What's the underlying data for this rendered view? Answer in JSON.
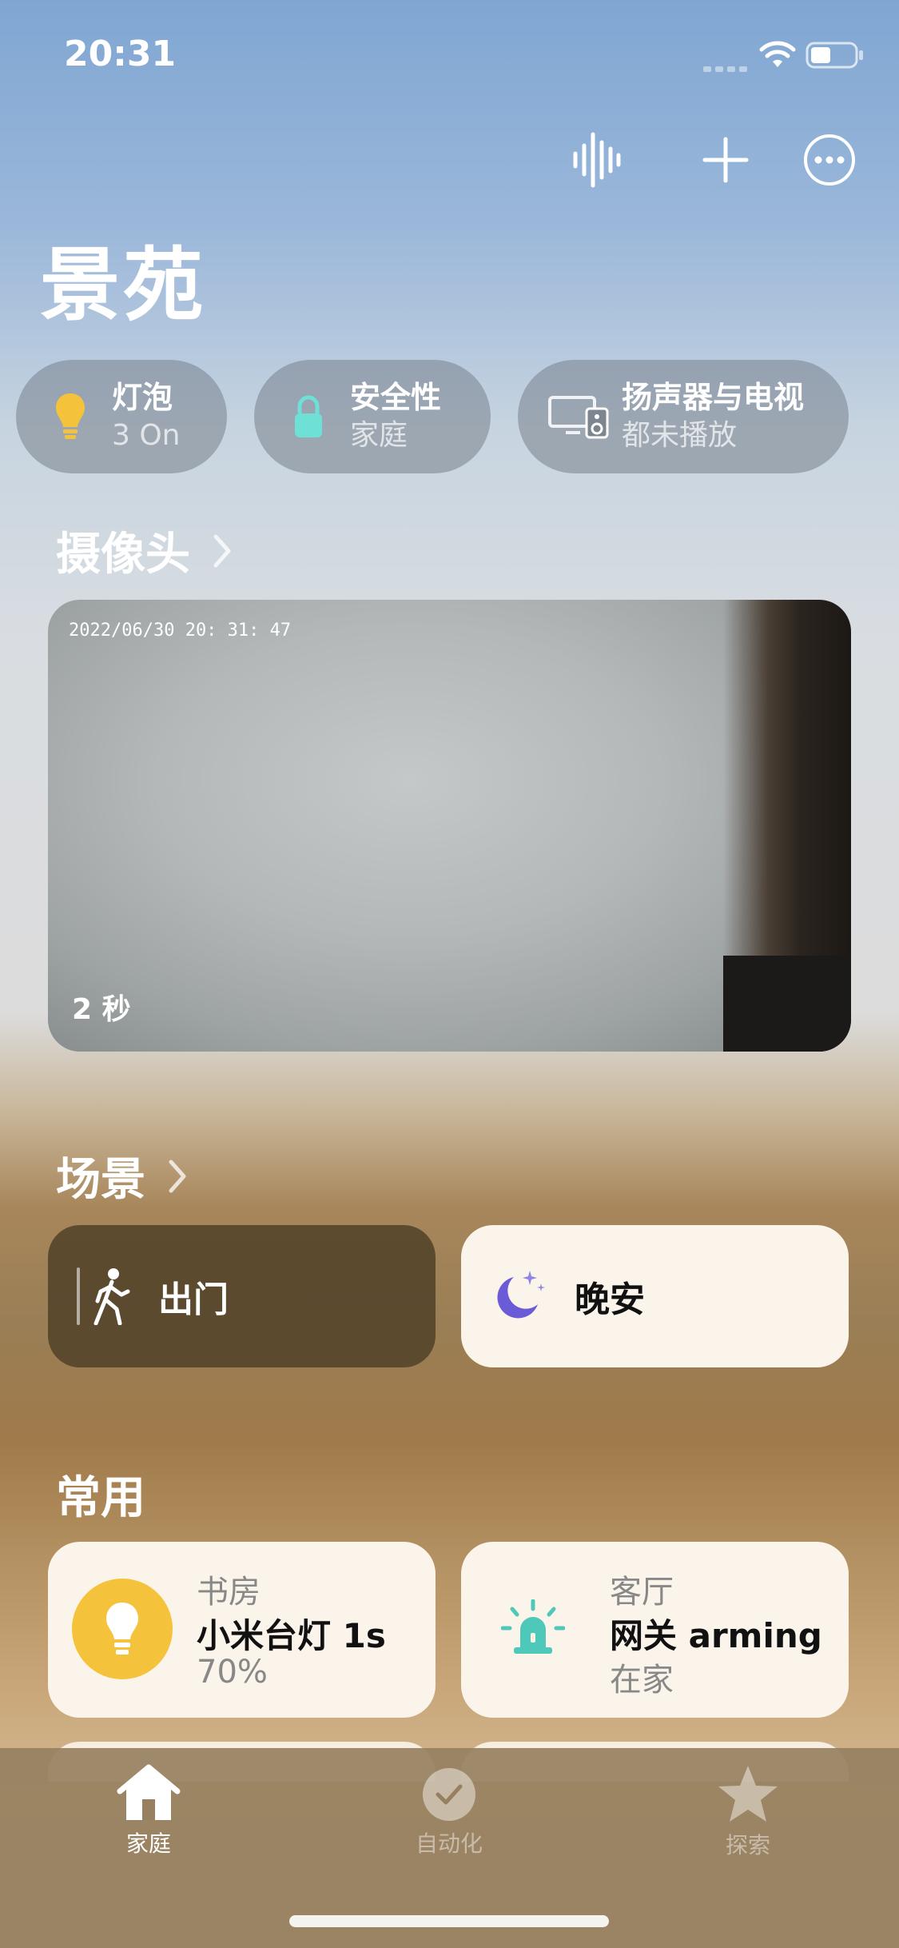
{
  "status_bar": {
    "time": "20:31"
  },
  "toolbar": {
    "icons": [
      "waveform-icon",
      "plus-icon",
      "more-icon"
    ]
  },
  "home": {
    "title": "景苑"
  },
  "status_pills": [
    {
      "title": "灯泡",
      "subtitle": "3 On",
      "icon": "lightbulb-icon"
    },
    {
      "title": "安全性",
      "subtitle": "家庭",
      "icon": "lock-icon"
    },
    {
      "title": "扬声器与电视",
      "subtitle": "都未播放",
      "icon": "speaker-tv-icon"
    }
  ],
  "cameras": {
    "title": "摄像头",
    "feed": {
      "timestamp": "2022/06/30  20: 31: 47",
      "age": "2 秒"
    }
  },
  "scenes": {
    "title": "场景",
    "items": [
      {
        "label": "出门",
        "icon": "walking-person-icon"
      },
      {
        "label": "晚安",
        "icon": "moon-stars-icon"
      }
    ]
  },
  "favorites": {
    "title": "常用",
    "items": [
      {
        "room": "书房",
        "name": "小米台灯 1s",
        "state": "70%",
        "icon": "lightbulb-icon"
      },
      {
        "room": "客厅",
        "name": "网关 arming",
        "state": "在家",
        "icon": "alarm-siren-icon"
      }
    ]
  },
  "tab_bar": {
    "tabs": [
      {
        "label": "家庭",
        "icon": "house-icon",
        "active": true
      },
      {
        "label": "自动化",
        "icon": "clock-check-icon",
        "active": false
      },
      {
        "label": "探索",
        "icon": "star-icon",
        "active": false
      }
    ]
  },
  "colors": {
    "accent_yellow": "#f5c33b",
    "siren_teal": "#4ec8b8",
    "moon_purple": "#6b5bd6"
  }
}
